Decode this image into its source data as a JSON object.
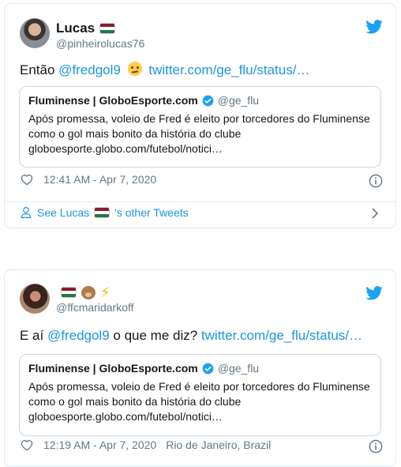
{
  "tweets": [
    {
      "display_name": "Lucas",
      "handle": "@pinheirolucas76",
      "text_prefix": "Então ",
      "mention": "@fredgol9",
      "text_mid": " ",
      "link": "twitter.com/ge_flu/status/…",
      "quote": {
        "name": "Fluminense | GloboEsporte.com",
        "handle": "@ge_flu",
        "line1": "Após promessa, voleio de Fred é eleito por torcedores do Fluminense",
        "line2": "como o gol mais bonito da história do clube",
        "line3": "globoesporte.globo.com/futebol/notici…"
      },
      "time": "12:41 AM - Apr 7, 2020",
      "see_more_prefix": "See Lucas ",
      "see_more_suffix": "'s other Tweets"
    },
    {
      "display_name": "",
      "handle": "@ffcmaridarkoff",
      "text_prefix": "E aí ",
      "mention": "@fredgol9",
      "text_mid": " o que me diz? ",
      "link": "twitter.com/ge_flu/status/…",
      "quote": {
        "name": "Fluminense | GloboEsporte.com",
        "handle": "@ge_flu",
        "line1": "Após promessa, voleio de Fred é eleito por torcedores do Fluminense",
        "line2": "como o gol mais bonito da história do clube",
        "line3": "globoesporte.globo.com/futebol/notici…"
      },
      "time": "12:19 AM - Apr 7, 2020",
      "location": "Rio de Janeiro, Brazil"
    }
  ],
  "icons": {
    "twitter": "twitter-bird-icon",
    "verified": "verified-badge-icon",
    "like": "heart-icon",
    "info": "info-icon",
    "profile": "person-icon",
    "next": "chevron-right-icon",
    "emoji": [
      "hungary-flag-icon",
      "thinking-face-icon",
      "bear-face-icon",
      "lightning-icon"
    ]
  },
  "colors": {
    "link": "#1b95e0",
    "secondary_text": "#657786",
    "border": "#e1e8ed"
  }
}
